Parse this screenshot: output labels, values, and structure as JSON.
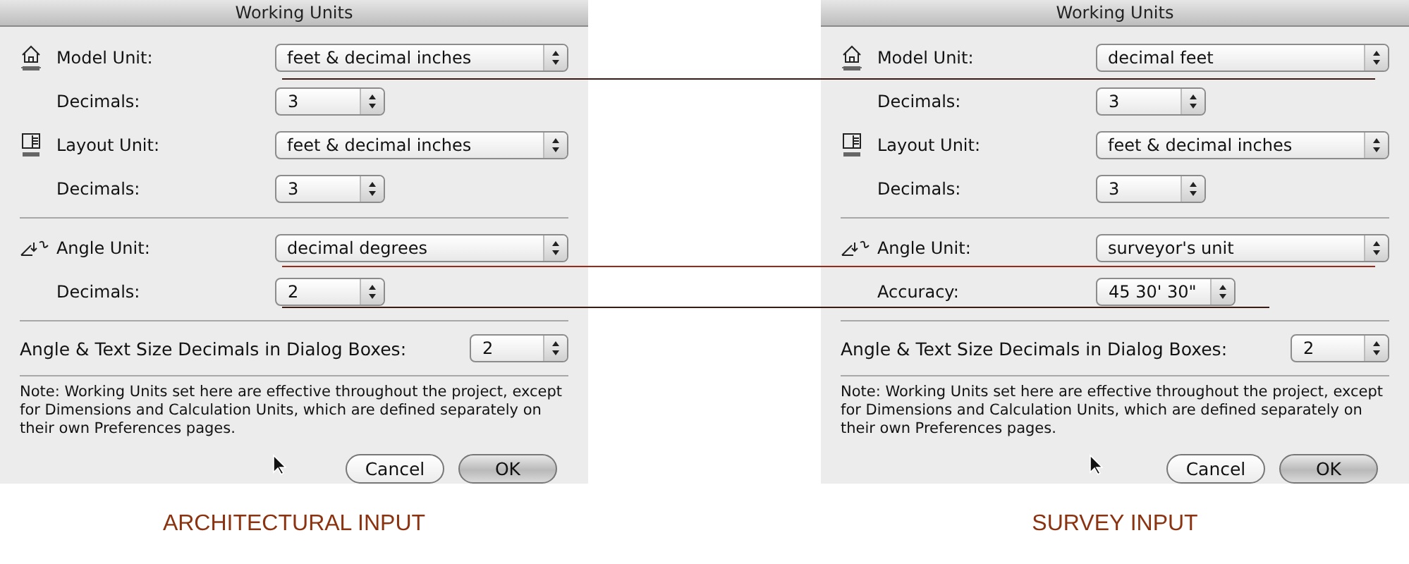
{
  "dialogs": [
    {
      "title": "Working Units",
      "caption": "ARCHITECTURAL INPUT",
      "rows": [
        {
          "kind": "model-unit",
          "label": "Model Unit:",
          "value": "feet & decimal inches"
        },
        {
          "kind": "sub-setting",
          "label": "Decimals:",
          "value": "3"
        },
        {
          "kind": "layout-unit",
          "label": "Layout Unit:",
          "value": "feet & decimal inches"
        },
        {
          "kind": "sub-setting",
          "label": "Decimals:",
          "value": "3"
        },
        {
          "kind": "angle-unit",
          "label": "Angle Unit:",
          "value": "decimal degrees"
        },
        {
          "kind": "sub-setting",
          "label": "Decimals:",
          "value": "2"
        }
      ],
      "dialog_decimals": {
        "label": "Angle & Text Size Decimals in Dialog Boxes:",
        "value": "2"
      },
      "note": "Note: Working Units set here are effective throughout the project, except for Dimensions and Calculation Units, which are defined separately on their own Preferences pages.",
      "buttons": [
        "Cancel",
        "OK"
      ]
    },
    {
      "title": "Working Units",
      "caption": "SURVEY INPUT",
      "rows": [
        {
          "kind": "model-unit",
          "label": "Model Unit:",
          "value": "decimal feet"
        },
        {
          "kind": "sub-setting",
          "label": "Decimals:",
          "value": "3"
        },
        {
          "kind": "layout-unit",
          "label": "Layout Unit:",
          "value": "feet & decimal inches"
        },
        {
          "kind": "sub-setting",
          "label": "Decimals:",
          "value": "3"
        },
        {
          "kind": "angle-unit",
          "label": "Angle Unit:",
          "value": "surveyor's unit"
        },
        {
          "kind": "sub-setting",
          "label": "Accuracy:",
          "value": "45 30' 30\""
        }
      ],
      "dialog_decimals": {
        "label": "Angle & Text Size Decimals in Dialog Boxes:",
        "value": "2"
      },
      "note": "Note: Working Units set here are effective throughout the project, except for Dimensions and Calculation Units, which are defined separately on their own Preferences pages.",
      "buttons": [
        "Cancel",
        "OK"
      ]
    }
  ]
}
